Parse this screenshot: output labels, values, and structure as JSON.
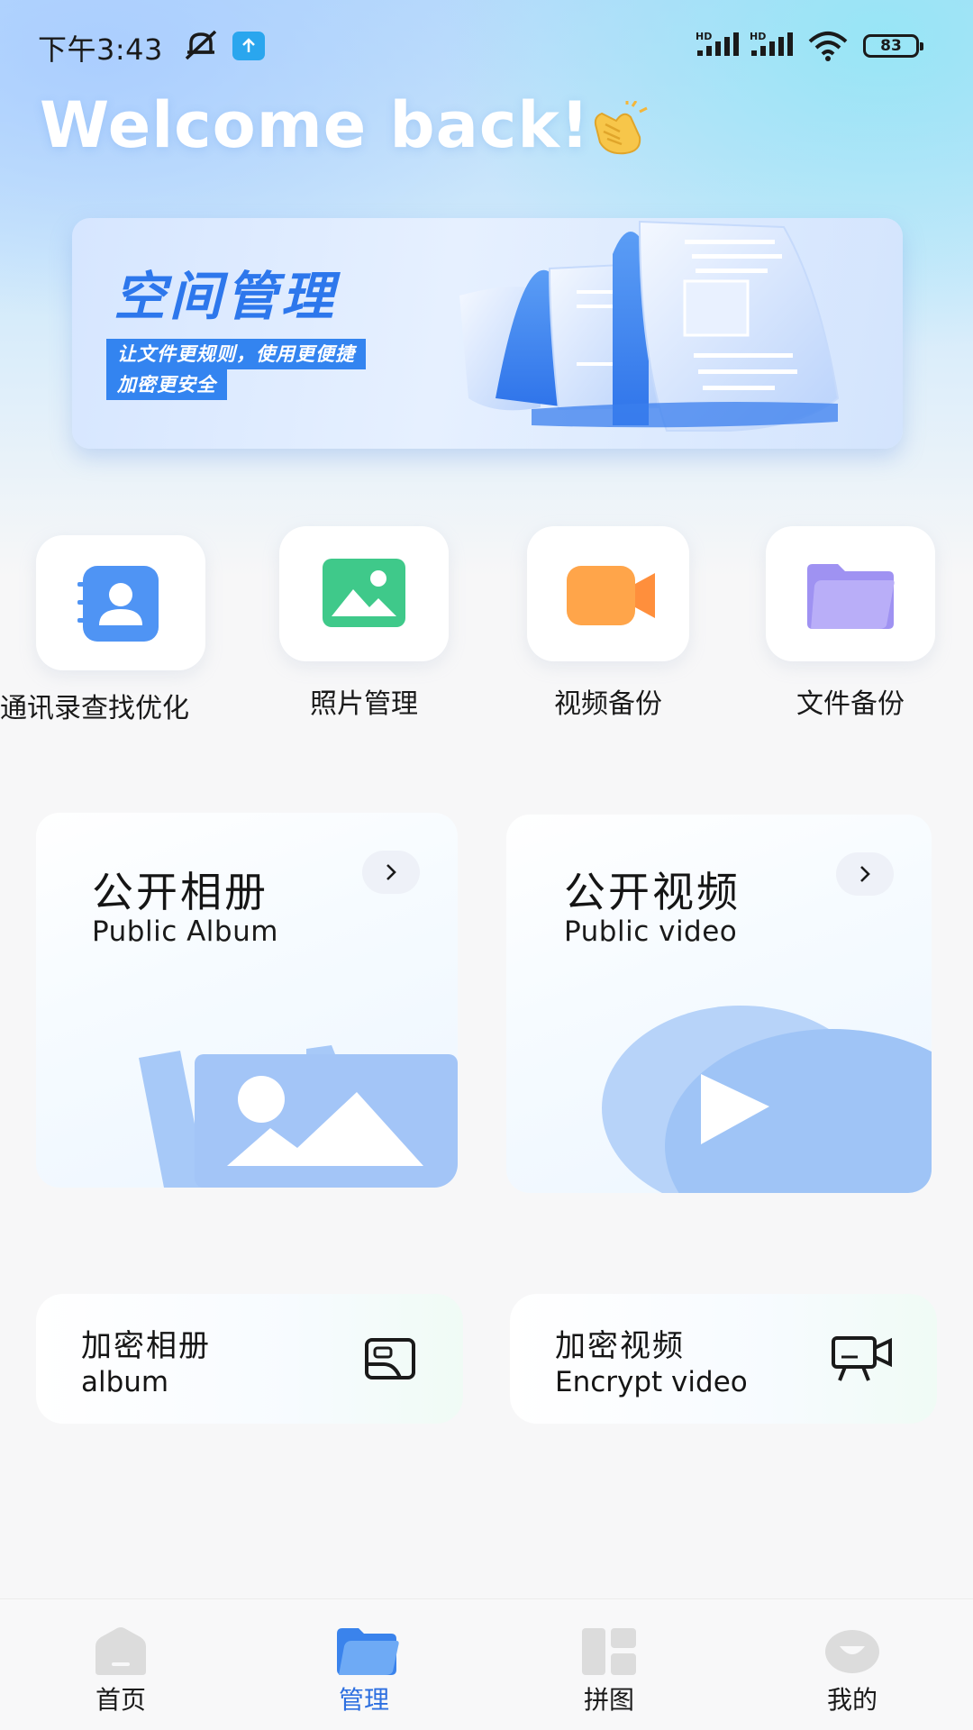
{
  "status_bar": {
    "time": "下午3:43",
    "battery": "83",
    "signal_label": "HD"
  },
  "welcome": {
    "text": "Welcome back!"
  },
  "banner": {
    "title": "空间管理",
    "subtitle_line1": "让文件更规则，使用更便捷",
    "subtitle_line2": "加密更安全"
  },
  "features": [
    {
      "label": "通讯录查找优化",
      "icon": "contacts-icon"
    },
    {
      "label": "照片管理",
      "icon": "photo-icon"
    },
    {
      "label": "视频备份",
      "icon": "video-camera-icon"
    },
    {
      "label": "文件备份",
      "icon": "folder-icon"
    }
  ],
  "public_cards": [
    {
      "title": "公开相册",
      "subtitle": "Public Album"
    },
    {
      "title": "公开视频",
      "subtitle": "Public video"
    }
  ],
  "encrypt_cards": [
    {
      "title": "加密相册",
      "subtitle": "album",
      "icon": "encrypted-album-icon"
    },
    {
      "title": "加密视频",
      "subtitle": "Encrypt video",
      "icon": "encrypted-video-icon"
    }
  ],
  "bottom_nav": {
    "active_index": 1,
    "items": [
      {
        "label": "首页",
        "icon": "home-icon"
      },
      {
        "label": "管理",
        "icon": "folder-icon"
      },
      {
        "label": "拼图",
        "icon": "grid-icon"
      },
      {
        "label": "我的",
        "icon": "profile-icon"
      }
    ]
  },
  "colors": {
    "accent": "#2d77ec",
    "nav_active": "#2d6fe0"
  }
}
